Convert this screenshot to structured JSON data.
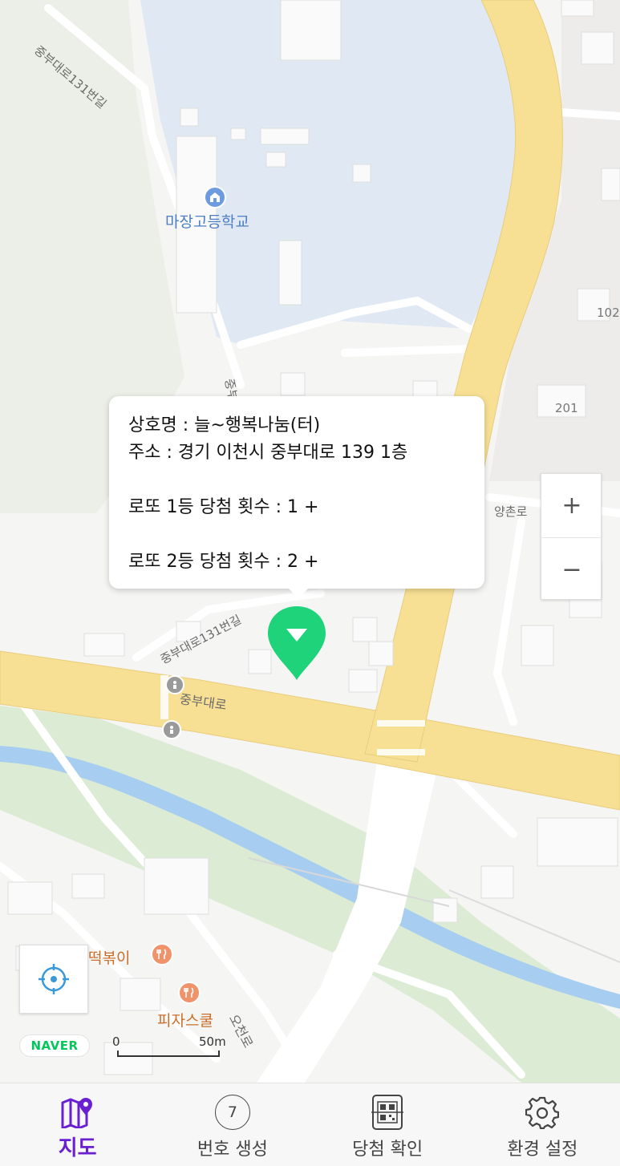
{
  "map": {
    "school_label": "마장고등학교",
    "road_labels": {
      "top": "중부대로131번길",
      "middle": "중부대로131번길",
      "main": "중부대로",
      "yangchon": "양촌로",
      "ocheon": "오천로",
      "vertical_fragment": "중부"
    },
    "building_numbers": [
      "102",
      "201"
    ],
    "poi": [
      {
        "name": "떡볶이",
        "icon": "restaurant-icon"
      },
      {
        "name": "피자스쿨",
        "icon": "restaurant-icon"
      }
    ],
    "logo": "NAVER",
    "scale": {
      "start": "0",
      "end": "50m"
    },
    "marker_color": "#1ed37a"
  },
  "popup": {
    "store_name": "상호명 : 늘~행복나눔(터)",
    "address": "주소 : 경기 이천시 중부대로 139  1층",
    "first_prize": "로또 1등 당첨 횟수 :  1 +",
    "second_prize": "로또 2등 당첨 횟수 :  2 +"
  },
  "zoom": {
    "in": "+",
    "out": "−"
  },
  "tabs": [
    {
      "label": "지도",
      "icon": "map-pin-icon",
      "active": true
    },
    {
      "label": "번호 생성",
      "icon": "number-circle-icon",
      "number": "7",
      "active": false
    },
    {
      "label": "당첨 확인",
      "icon": "qr-scan-icon",
      "active": false
    },
    {
      "label": "환경 설정",
      "icon": "gear-icon",
      "active": false
    }
  ],
  "colors": {
    "accent": "#6a1fd1",
    "road": "#f7df93",
    "water": "#a7cdf0",
    "park": "#d9ecd0"
  }
}
